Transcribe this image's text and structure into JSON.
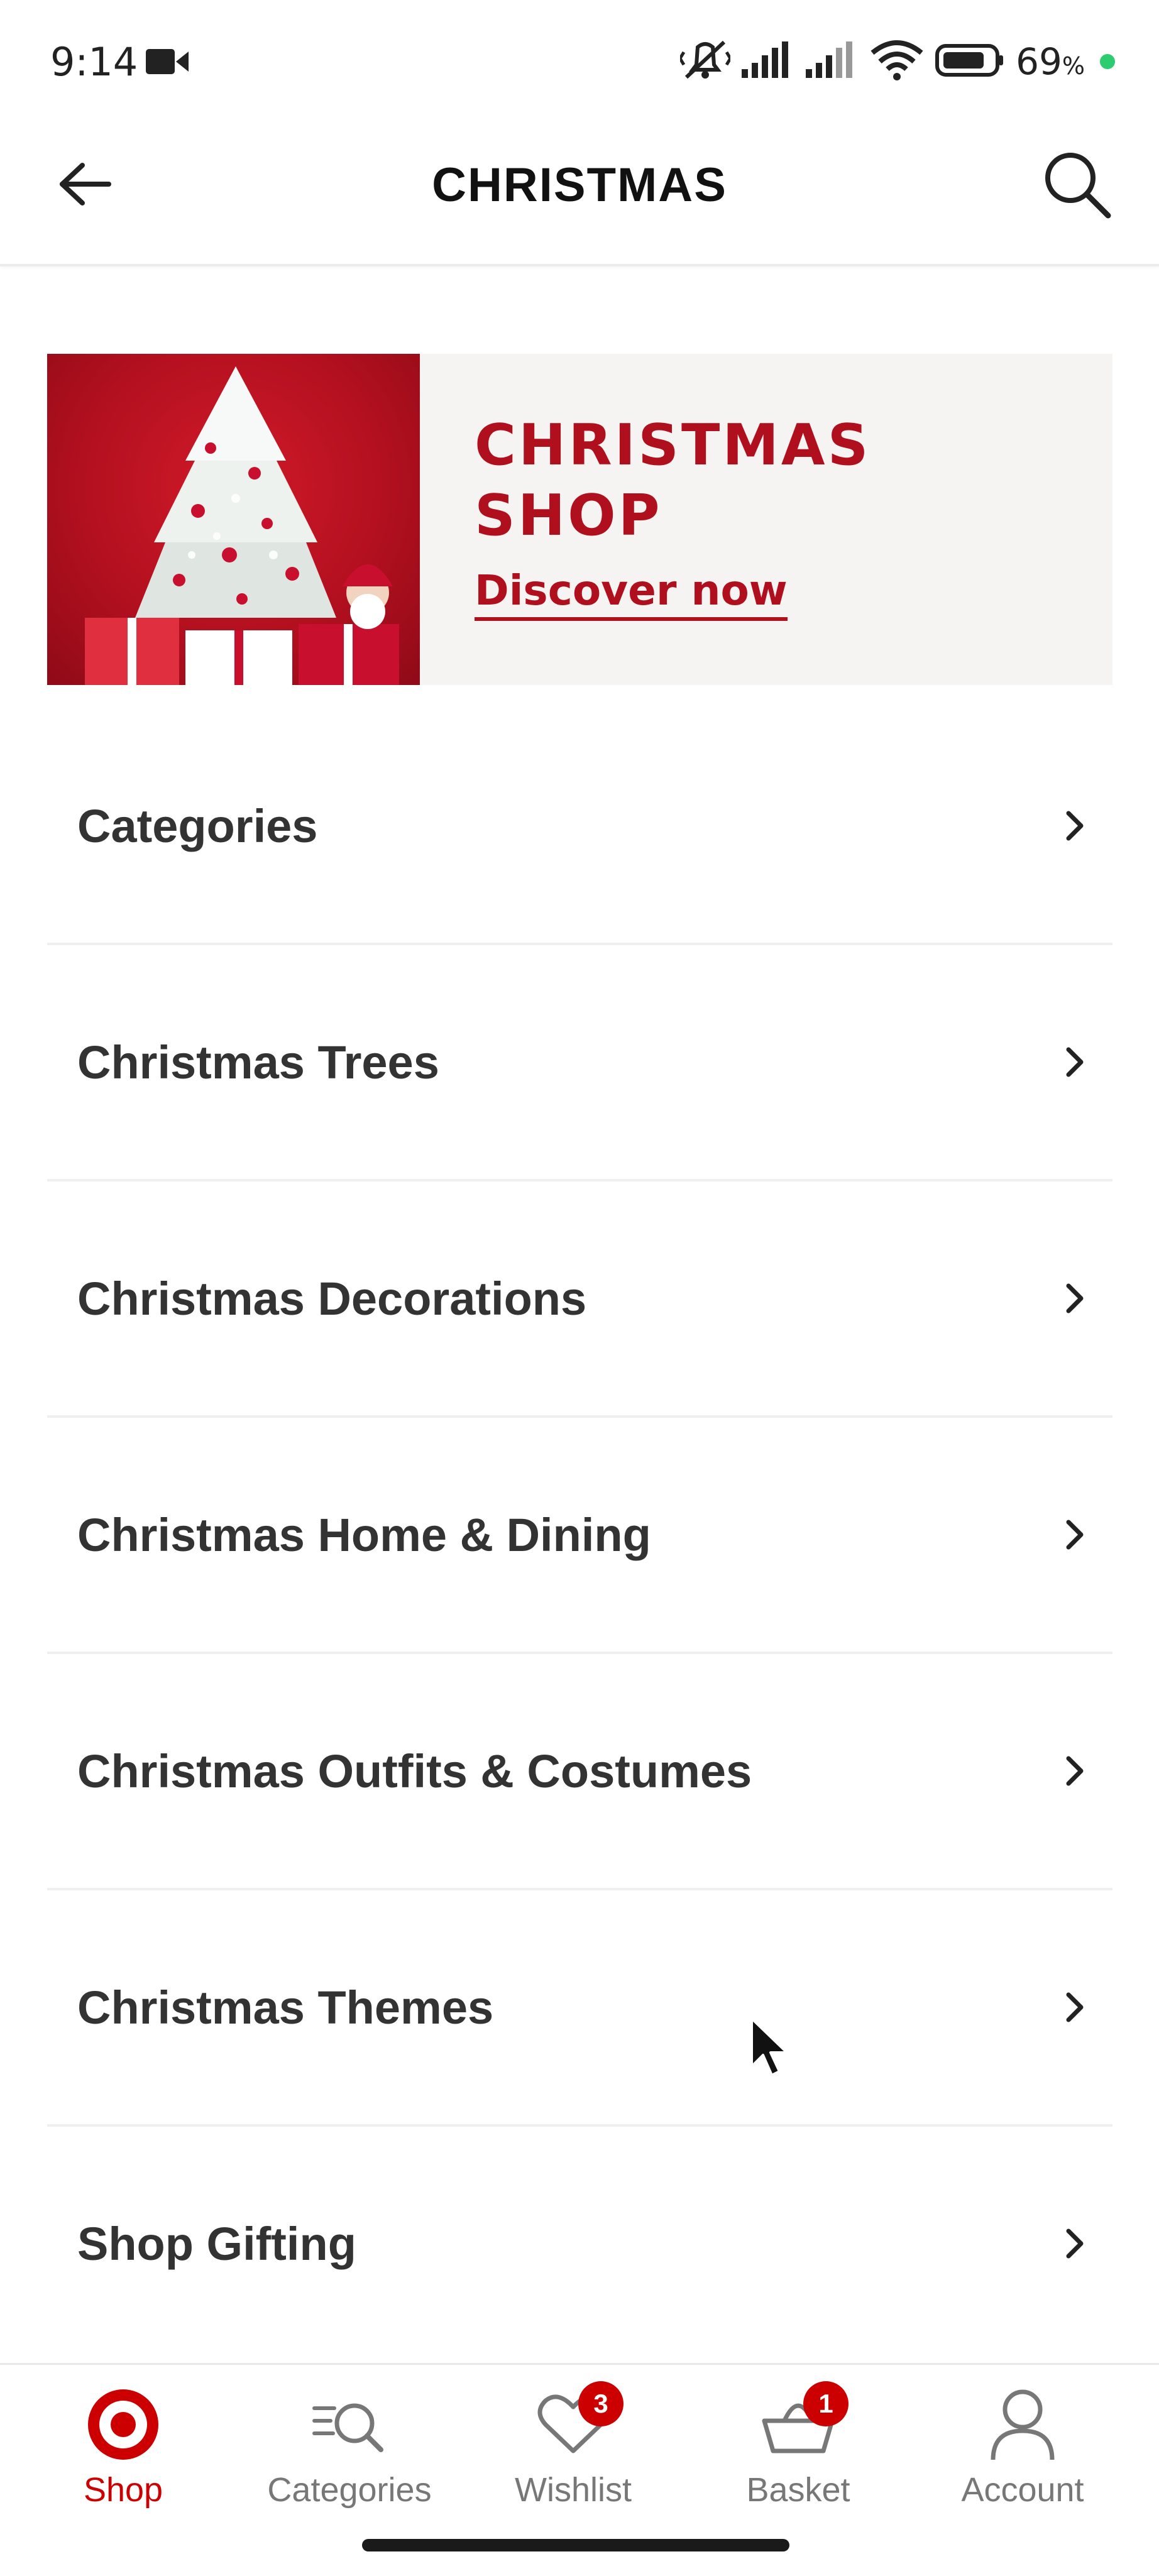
{
  "status_bar": {
    "time": "9:14",
    "battery_percent": "69",
    "battery_unit": "%"
  },
  "header": {
    "title": "CHRISTMAS",
    "back_icon": "arrow-left-icon",
    "search_icon": "search-icon"
  },
  "banner": {
    "title": "CHRISTMAS\nSHOP",
    "cta": "Discover now"
  },
  "menu": {
    "items": [
      {
        "label": "Categories"
      },
      {
        "label": "Christmas Trees"
      },
      {
        "label": "Christmas Decorations"
      },
      {
        "label": "Christmas Home & Dining"
      },
      {
        "label": "Christmas Outfits & Costumes"
      },
      {
        "label": "Christmas Themes"
      },
      {
        "label": "Shop Gifting"
      }
    ]
  },
  "bottom_nav": {
    "items": [
      {
        "label": "Shop",
        "icon": "target-logo-icon",
        "active": true
      },
      {
        "label": "Categories",
        "icon": "categories-search-icon"
      },
      {
        "label": "Wishlist",
        "icon": "heart-icon",
        "badge": "3"
      },
      {
        "label": "Basket",
        "icon": "basket-icon",
        "badge": "1"
      },
      {
        "label": "Account",
        "icon": "person-icon"
      }
    ]
  },
  "colors": {
    "brand_red": "#cc0000",
    "banner_red": "#b0101e",
    "text_dark": "#333333",
    "nav_inactive": "#777777"
  }
}
